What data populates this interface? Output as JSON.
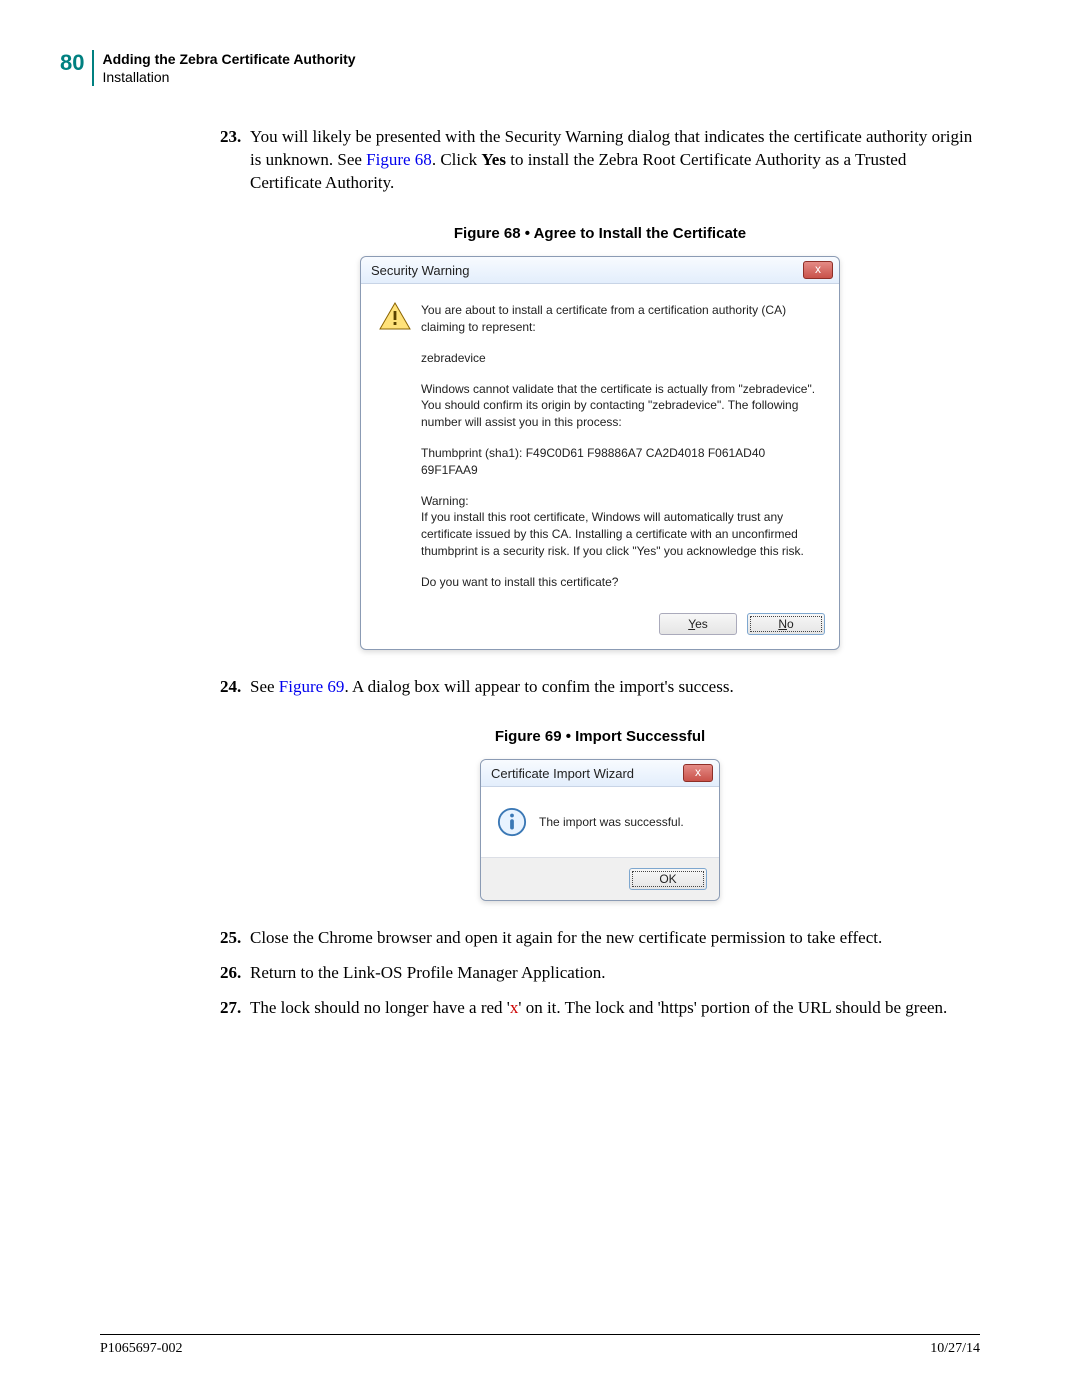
{
  "page_number": "80",
  "header_title": "Adding the Zebra Certificate Authority",
  "header_sub": "Installation",
  "step23": {
    "num": "23.",
    "t1": "You will likely be presented with the Security Warning dialog that indicates the certificate authority origin is unknown. See ",
    "link": "Figure 68",
    "t2": ". Click ",
    "bold": "Yes",
    "t3": " to install the Zebra Root Certificate Authority as a Trusted Certificate Authority."
  },
  "fig68_caption": "Figure 68 • Agree to Install the Certificate",
  "dialog1": {
    "title": "Security Warning",
    "close": "x",
    "msg1": "You are about to install a certificate from a certification authority (CA) claiming to represent:",
    "subject": "zebradevice",
    "msg2": "Windows cannot validate that the certificate is actually from \"zebradevice\". You should confirm its origin by contacting \"zebradevice\". The following number will assist you in this process:",
    "thumb": "Thumbprint (sha1): F49C0D61 F98886A7 CA2D4018 F061AD40 69F1FAA9",
    "warn_label": "Warning:",
    "warn_text": "If you install this root certificate, Windows will automatically trust any certificate issued by this CA. Installing a certificate with an unconfirmed thumbprint is a security risk. If you click \"Yes\" you acknowledge this risk.",
    "question": "Do you want to install this certificate?",
    "yes": "Yes",
    "yes_accesskey": "Y",
    "no": "No",
    "no_accesskey": "N"
  },
  "step24": {
    "num": "24.",
    "t1": "See ",
    "link": "Figure 69",
    "t2": ". A dialog box will appear to confim the import's success."
  },
  "fig69_caption": "Figure 69 • Import Successful",
  "dialog2": {
    "title": "Certificate Import Wizard",
    "close": "x",
    "msg": "The import was successful.",
    "ok": "OK"
  },
  "step25": {
    "num": "25.",
    "text": "Close the Chrome browser and open it again for the new certificate permission to take effect."
  },
  "step26": {
    "num": "26.",
    "text": "Return to the Link-OS Profile Manager Application."
  },
  "step27": {
    "num": "27.",
    "t1": "The lock should no longer have a red '",
    "x": "x",
    "t2": "' on it. The lock and 'https' portion of the URL should be green."
  },
  "footer_left": "P1065697-002",
  "footer_right": "10/27/14"
}
